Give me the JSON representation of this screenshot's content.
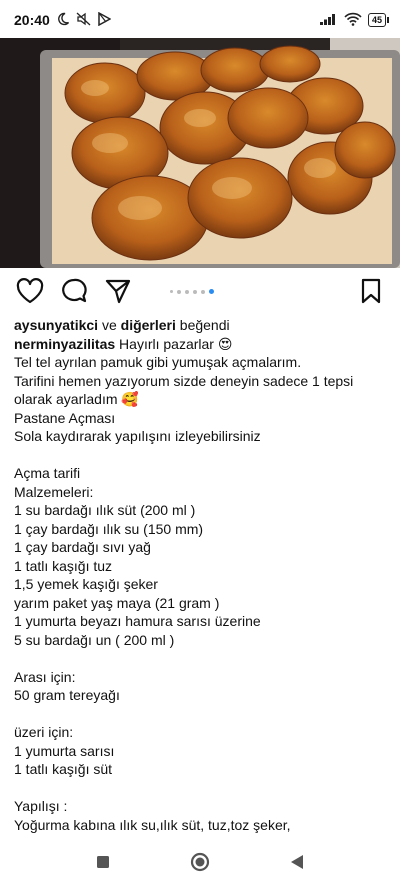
{
  "status_bar": {
    "time": "20:40",
    "battery": "45"
  },
  "post": {
    "carousel": {
      "count": 5,
      "active_index": 4
    },
    "likes": {
      "user": "aysunyatikci",
      "connector": "ve",
      "others": "diğerleri",
      "suffix": "beğendi"
    },
    "caption": {
      "author": "nerminyazilitas",
      "first_line": "Hayırlı pazarlar 😍",
      "lines": [
        "Tel tel ayrılan pamuk gibi yumuşak açmalarım.",
        "Tarifini hemen yazıyorum sizde deneyin sadece 1 tepsi",
        "olarak ayarladım 🥰",
        "Pastane Açması",
        "Sola kaydırarak yapılışını izleyebilirsiniz",
        "",
        "Açma tarifi",
        "Malzemeleri:",
        "1 su bardağı ılık süt (200 ml )",
        "1 çay bardağı ılık su (150 mm)",
        "1 çay bardağı sıvı yağ",
        "1 tatlı kaşığı tuz",
        "1,5 yemek kaşığı şeker",
        "yarım paket yaş maya (21 gram )",
        "1 yumurta beyazı hamura sarısı üzerine",
        "5 su bardağı un ( 200 ml )",
        "",
        "Arası için:",
        "50 gram tereyağı",
        "",
        "üzeri için:",
        "1 yumurta sarısı",
        "1 tatlı kaşığı süt",
        "",
        "Yapılışı :",
        "Yoğurma kabına ılık su,ılık süt, tuz,toz şeker,"
      ]
    }
  }
}
